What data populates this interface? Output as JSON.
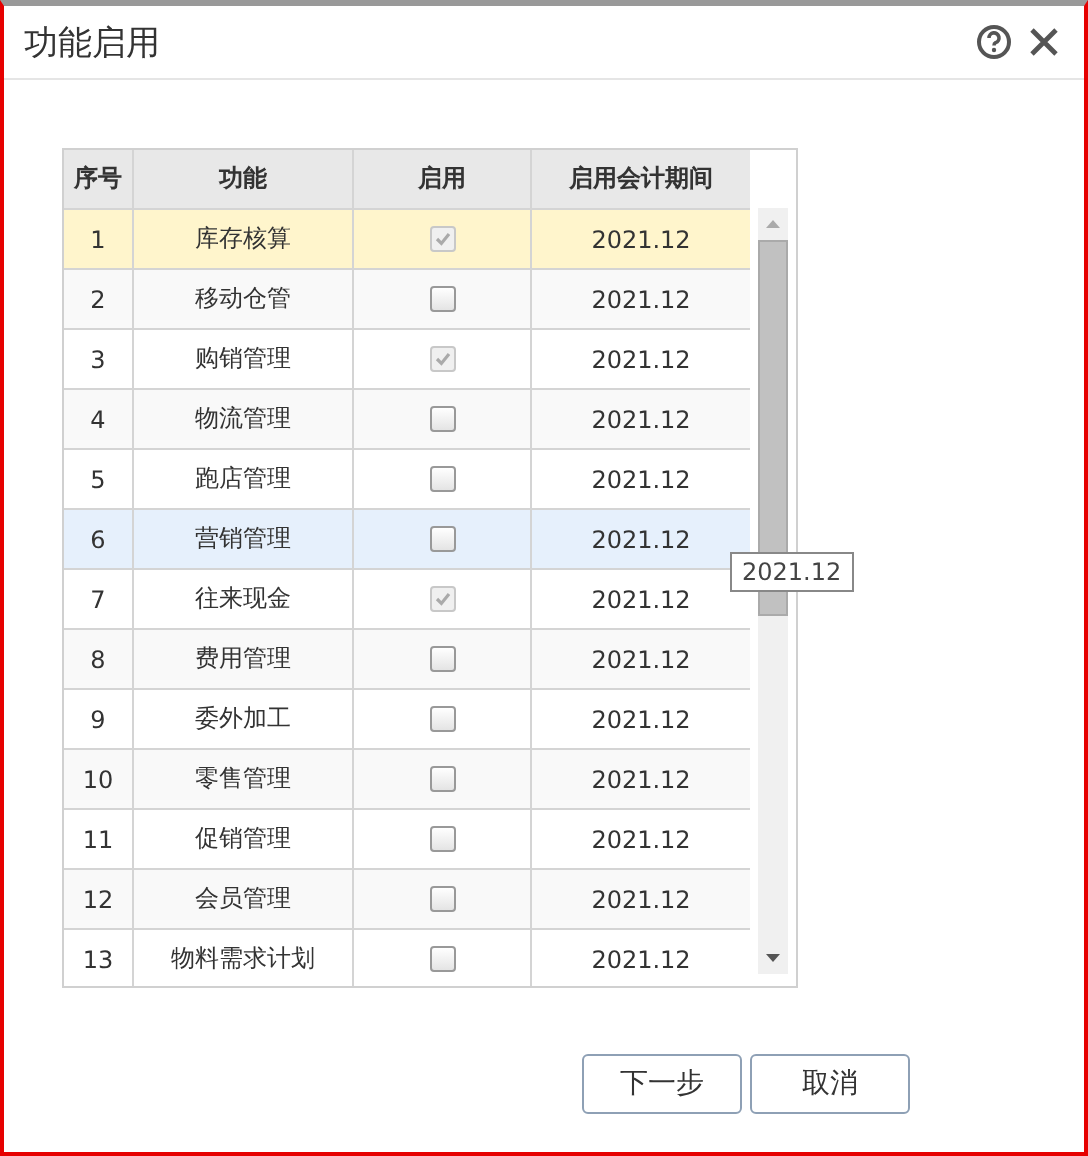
{
  "window": {
    "title": "功能启用"
  },
  "table": {
    "columns": [
      "序号",
      "功能",
      "启用",
      "启用会计期间"
    ],
    "rows": [
      {
        "index": "1",
        "name": "库存核算",
        "checked": true,
        "disabled": true,
        "period": "2021.12",
        "selected": true,
        "hovered": false
      },
      {
        "index": "2",
        "name": "移动仓管",
        "checked": false,
        "disabled": false,
        "period": "2021.12",
        "selected": false,
        "hovered": false
      },
      {
        "index": "3",
        "name": "购销管理",
        "checked": true,
        "disabled": true,
        "period": "2021.12",
        "selected": false,
        "hovered": false
      },
      {
        "index": "4",
        "name": "物流管理",
        "checked": false,
        "disabled": false,
        "period": "2021.12",
        "selected": false,
        "hovered": false
      },
      {
        "index": "5",
        "name": "跑店管理",
        "checked": false,
        "disabled": false,
        "period": "2021.12",
        "selected": false,
        "hovered": false
      },
      {
        "index": "6",
        "name": "营销管理",
        "checked": false,
        "disabled": false,
        "period": "2021.12",
        "selected": false,
        "hovered": true
      },
      {
        "index": "7",
        "name": "往来现金",
        "checked": true,
        "disabled": true,
        "period": "2021.12",
        "selected": false,
        "hovered": false
      },
      {
        "index": "8",
        "name": "费用管理",
        "checked": false,
        "disabled": false,
        "period": "2021.12",
        "selected": false,
        "hovered": false
      },
      {
        "index": "9",
        "name": "委外加工",
        "checked": false,
        "disabled": false,
        "period": "2021.12",
        "selected": false,
        "hovered": false
      },
      {
        "index": "10",
        "name": "零售管理",
        "checked": false,
        "disabled": false,
        "period": "2021.12",
        "selected": false,
        "hovered": false
      },
      {
        "index": "11",
        "name": "促销管理",
        "checked": false,
        "disabled": false,
        "period": "2021.12",
        "selected": false,
        "hovered": false
      },
      {
        "index": "12",
        "name": "会员管理",
        "checked": false,
        "disabled": false,
        "period": "2021.12",
        "selected": false,
        "hovered": false
      },
      {
        "index": "13",
        "name": "物料需求计划",
        "checked": false,
        "disabled": false,
        "period": "2021.12",
        "selected": false,
        "hovered": false
      }
    ]
  },
  "tooltip": {
    "text": "2021.12"
  },
  "buttons": [
    "下一步",
    "取消"
  ]
}
